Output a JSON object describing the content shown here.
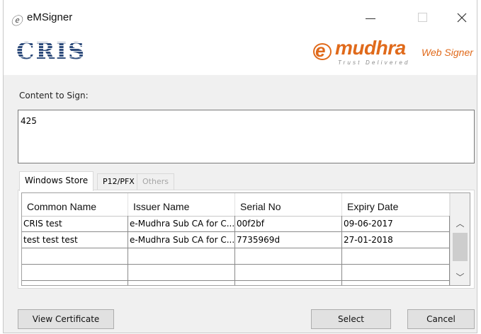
{
  "window": {
    "title": "eMSigner",
    "icon": "e-circle-icon"
  },
  "banner": {
    "left_logo_text": "CRIS",
    "right_logo": {
      "e": "e",
      "name": "mudhra",
      "product": "Web Signer",
      "tagline": "Trust Delivered"
    }
  },
  "content": {
    "label": "Content to Sign:",
    "value": "425"
  },
  "tabs": [
    {
      "label": "Windows Store",
      "state": "active"
    },
    {
      "label": "P12/PFX",
      "state": "inactive"
    },
    {
      "label": "Others",
      "state": "disabled"
    }
  ],
  "table": {
    "columns": [
      "Common Name",
      "Issuer Name",
      "Serial No",
      "Expiry Date"
    ],
    "rows": [
      [
        "CRIS test",
        "e-Mudhra Sub CA for C...",
        "00f2bf",
        "09-06-2017"
      ],
      [
        "test test test",
        "e-Mudhra Sub CA for C...",
        "7735969d",
        "27-01-2018"
      ],
      [
        "",
        "",
        "",
        ""
      ],
      [
        "",
        "",
        "",
        ""
      ],
      [
        "",
        "",
        "",
        ""
      ]
    ]
  },
  "buttons": {
    "view_certificate": "View Certificate",
    "select": "Select",
    "cancel": "Cancel"
  },
  "colors": {
    "brand_orange": "#e06a1b",
    "cris_blue": "#2c4a7a"
  }
}
